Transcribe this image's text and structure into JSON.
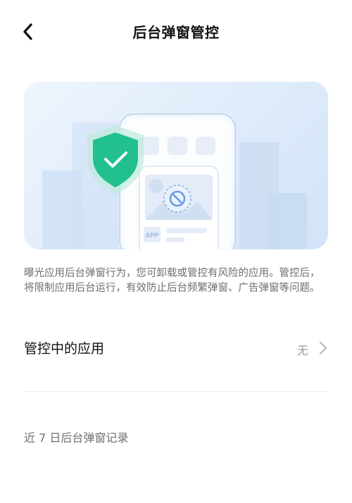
{
  "header": {
    "title": "后台弹窗管控",
    "back_icon": "back-arrow-icon"
  },
  "banner": {
    "app_label": "APP",
    "shield_icon": "shield-check-icon",
    "blocked_icon": "prohibited-icon",
    "colors": {
      "shield": "#22c08e",
      "accent_blue": "#6aa2e2"
    }
  },
  "description": "曝光应用后台弹窗行为，您可卸载或管控有风险的应用。管控后，将限制应用后台运行，有效防止后台频繁弹窗、广告弹窗等问题。",
  "controlled_apps": {
    "label": "管控中的应用",
    "value": "无",
    "chevron_icon": "chevron-right-icon"
  },
  "records": {
    "title": "近 7 日后台弹窗记录"
  }
}
